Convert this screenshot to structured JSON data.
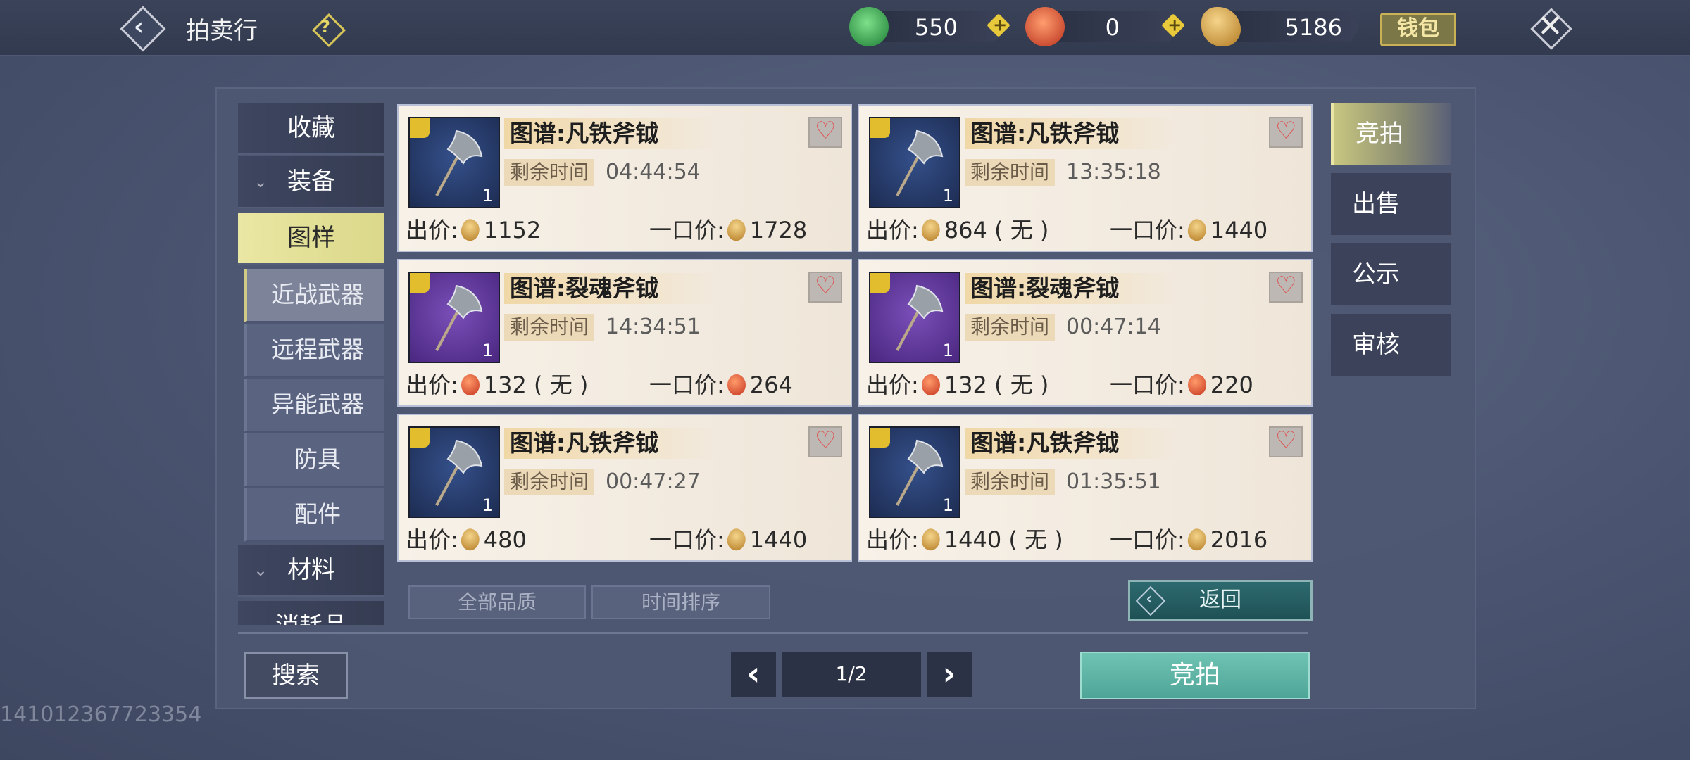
{
  "header": {
    "title": "拍卖行",
    "help": "?",
    "currencies": [
      {
        "icon": "jade-dragon-icon",
        "value": "550"
      },
      {
        "icon": "red-coin-icon",
        "value": "0"
      },
      {
        "icon": "gold-leaf-icon",
        "value": "5186"
      }
    ],
    "wallet_label": "钱包"
  },
  "left_nav": [
    {
      "label": "收藏",
      "type": "top"
    },
    {
      "label": "装备",
      "type": "group"
    },
    {
      "label": "图样",
      "type": "selected"
    },
    {
      "label": "近战武器",
      "type": "sub-selected"
    },
    {
      "label": "远程武器",
      "type": "sub"
    },
    {
      "label": "异能武器",
      "type": "sub"
    },
    {
      "label": "防具",
      "type": "sub"
    },
    {
      "label": "配件",
      "type": "sub"
    },
    {
      "label": "材料",
      "type": "group"
    },
    {
      "label": "消耗品",
      "type": "partial"
    }
  ],
  "items": [
    {
      "name": "图谱:凡铁斧钺",
      "remain_label": "剩余时间",
      "time": "04:44:54",
      "bid_label": "出价:",
      "bid": "1152",
      "bid_coin": "gold",
      "buy_label": "一口价:",
      "buy": "1728",
      "buy_coin": "gold",
      "qty": "1",
      "rarity": "blue"
    },
    {
      "name": "图谱:凡铁斧钺",
      "remain_label": "剩余时间",
      "time": "13:35:18",
      "bid_label": "出价:",
      "bid": "864 ( 无 )",
      "bid_coin": "gold",
      "buy_label": "一口价:",
      "buy": "1440",
      "buy_coin": "gold",
      "qty": "1",
      "rarity": "blue"
    },
    {
      "name": "图谱:裂魂斧钺",
      "remain_label": "剩余时间",
      "time": "14:34:51",
      "bid_label": "出价:",
      "bid": "132 ( 无 )",
      "bid_coin": "red",
      "buy_label": "一口价:",
      "buy": "264",
      "buy_coin": "red",
      "qty": "1",
      "rarity": "purple"
    },
    {
      "name": "图谱:裂魂斧钺",
      "remain_label": "剩余时间",
      "time": "00:47:14",
      "bid_label": "出价:",
      "bid": "132 ( 无 )",
      "bid_coin": "red",
      "buy_label": "一口价:",
      "buy": "220",
      "buy_coin": "red",
      "qty": "1",
      "rarity": "purple"
    },
    {
      "name": "图谱:凡铁斧钺",
      "remain_label": "剩余时间",
      "time": "00:47:27",
      "bid_label": "出价:",
      "bid": "480",
      "bid_coin": "gold",
      "buy_label": "一口价:",
      "buy": "1440",
      "buy_coin": "gold",
      "qty": "1",
      "rarity": "blue"
    },
    {
      "name": "图谱:凡铁斧钺",
      "remain_label": "剩余时间",
      "time": "01:35:51",
      "bid_label": "出价:",
      "bid": "1440 ( 无 )",
      "bid_coin": "gold",
      "buy_label": "一口价:",
      "buy": "2016",
      "buy_coin": "gold",
      "qty": "1",
      "rarity": "blue"
    }
  ],
  "filters": {
    "quality": "全部品质",
    "sort": "时间排序"
  },
  "return_label": "返回",
  "search_label": "搜索",
  "pagination": {
    "text": "1/2"
  },
  "action_label": "竞拍",
  "right_tabs": [
    "竞拍",
    "出售",
    "公示",
    "审核"
  ],
  "player_id": "141012367723354"
}
